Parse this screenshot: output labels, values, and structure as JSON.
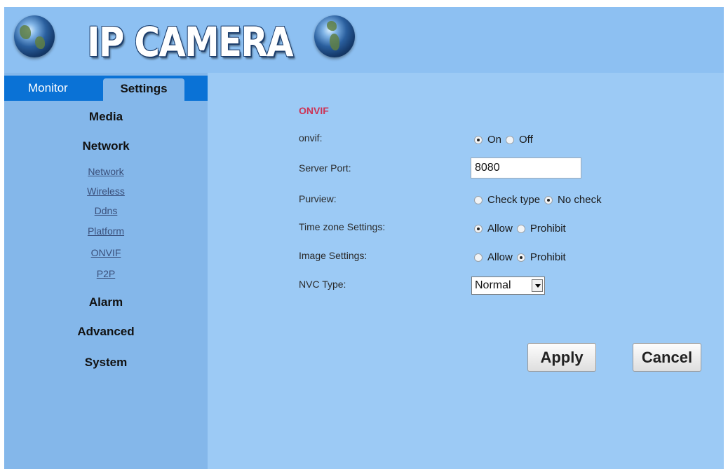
{
  "header": {
    "title": "IP CAMERA",
    "left_icon": "globe-icon",
    "right_icon": "globe-icon"
  },
  "tabs": {
    "monitor": "Monitor",
    "settings": "Settings"
  },
  "sidebar": {
    "media": "Media",
    "network": "Network",
    "network_items": [
      "Network",
      "Wireless",
      "Ddns",
      "Platform",
      "ONVIF",
      "P2P"
    ],
    "alarm": "Alarm",
    "advanced": "Advanced",
    "system": "System"
  },
  "form": {
    "section_title": "ONVIF",
    "onvif": {
      "label": "onvif:",
      "options": [
        "On",
        "Off"
      ],
      "selected": "On"
    },
    "server_port": {
      "label": "Server Port:",
      "value": "8080"
    },
    "purview": {
      "label": "Purview:",
      "options": [
        "Check type",
        "No check"
      ],
      "selected": "No check"
    },
    "time_zone": {
      "label": "Time zone Settings:",
      "options": [
        "Allow",
        "Prohibit"
      ],
      "selected": "Allow"
    },
    "image": {
      "label": "Image Settings:",
      "options": [
        "Allow",
        "Prohibit"
      ],
      "selected": "Prohibit"
    },
    "nvc_type": {
      "label": "NVC Type:",
      "value": "Normal"
    }
  },
  "buttons": {
    "apply": "Apply",
    "cancel": "Cancel"
  },
  "colors": {
    "panel_bg": "#9ccaf5",
    "sidebar_bg": "#84b7ea",
    "tabbar_bg": "#0a72d6",
    "section_title": "#cc3355"
  }
}
